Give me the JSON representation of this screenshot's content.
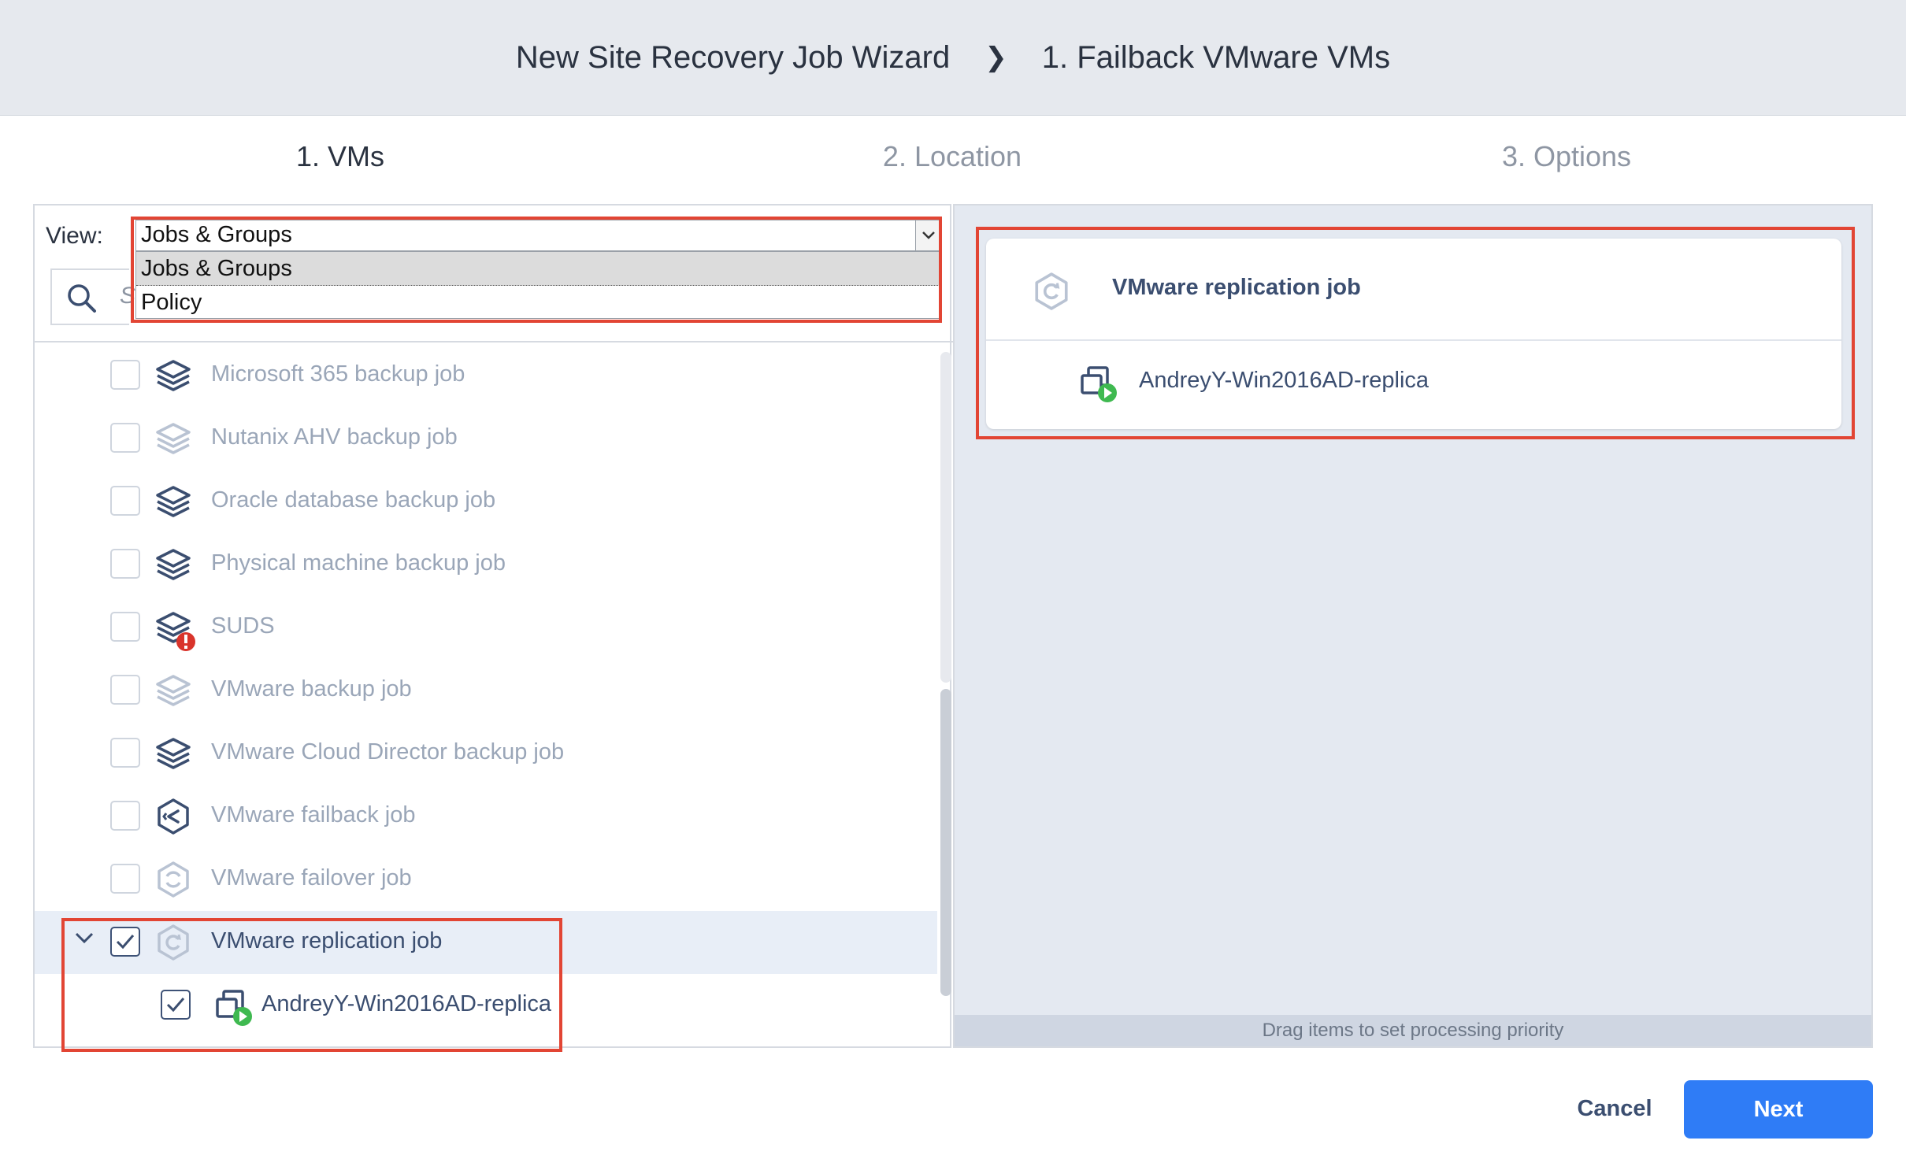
{
  "header": {
    "wizard_title": "New Site Recovery Job Wizard",
    "separator": "❯",
    "page_title": "1. Failback VMware VMs"
  },
  "steps": [
    {
      "label": "1. VMs",
      "active": true
    },
    {
      "label": "2. Location",
      "active": false
    },
    {
      "label": "3. Options",
      "active": false
    }
  ],
  "view": {
    "label": "View:",
    "selected": "Jobs & Groups",
    "options": [
      "Jobs & Groups",
      "Policy"
    ]
  },
  "search": {
    "placeholder_fragment": "S",
    "icon": "search-icon"
  },
  "tree": {
    "rows": [
      {
        "label": "Microsoft 365 backup job",
        "icon": "layers-icon",
        "checked": false
      },
      {
        "label": "Nutanix AHV backup job",
        "icon": "layers-icon",
        "checked": false
      },
      {
        "label": "Oracle database backup job",
        "icon": "layers-icon",
        "checked": false
      },
      {
        "label": "Physical machine backup job",
        "icon": "layers-icon",
        "checked": false
      },
      {
        "label": "SUDS",
        "icon": "layers-error-icon",
        "checked": false
      },
      {
        "label": "VMware backup job",
        "icon": "layers-icon",
        "checked": false
      },
      {
        "label": "VMware Cloud Director backup job",
        "icon": "layers-icon",
        "checked": false
      },
      {
        "label": "VMware failback job",
        "icon": "failback-icon",
        "checked": false
      },
      {
        "label": "VMware failover job",
        "icon": "failover-icon",
        "checked": false
      },
      {
        "label": "VMware replication job",
        "icon": "replication-icon",
        "checked": true,
        "expanded": true
      },
      {
        "label": "AndreyY-Win2016AD-replica",
        "icon": "vm-replica-icon",
        "checked": true,
        "child": true
      }
    ]
  },
  "selection_panel": {
    "job_title": "VMware replication job",
    "item_label": "AndreyY-Win2016AD-replica",
    "drag_hint": "Drag items to set processing priority"
  },
  "footer": {
    "cancel_label": "Cancel",
    "next_label": "Next"
  },
  "colors": {
    "accent": "#2f7cf6",
    "highlight": "#e24534",
    "text_dark": "#3b4e70",
    "text_muted": "#9aa6b8"
  }
}
